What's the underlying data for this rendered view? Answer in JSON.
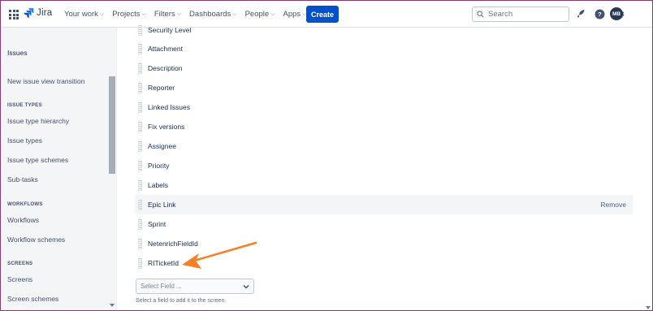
{
  "topnav": {
    "logo_text": "Jira",
    "items": [
      {
        "label": "Your work"
      },
      {
        "label": "Projects"
      },
      {
        "label": "Filters"
      },
      {
        "label": "Dashboards"
      },
      {
        "label": "People"
      },
      {
        "label": "Apps"
      }
    ],
    "create_label": "Create",
    "search_placeholder": "Search",
    "avatar_initials": "MB",
    "icons": [
      "app-switcher-icon",
      "jira-logo-icon",
      "notifications-icon",
      "help-icon",
      "settings-icon"
    ],
    "colors": {
      "create_button": "#0052cc",
      "avatar": "#253858"
    }
  },
  "sidebar": {
    "title": "Issues",
    "items": {
      "new_issue_view": "New issue view transition",
      "issue_types_section": "ISSUE TYPES",
      "issue_type_hierarchy": "Issue type hierarchy",
      "issue_types": "Issue types",
      "issue_type_schemes": "Issue type schemes",
      "sub_tasks": "Sub-tasks",
      "workflows_section": "WORKFLOWS",
      "workflows": "Workflows",
      "workflow_schemes": "Workflow schemes",
      "screens_section": "SCREENS",
      "screens": "Screens",
      "screen_schemes": "Screen schemes"
    }
  },
  "main": {
    "fields": [
      {
        "label": "Security Level"
      },
      {
        "label": "Attachment"
      },
      {
        "label": "Description"
      },
      {
        "label": "Reporter"
      },
      {
        "label": "Linked Issues"
      },
      {
        "label": "Fix versions"
      },
      {
        "label": "Assignee"
      },
      {
        "label": "Priority"
      },
      {
        "label": "Labels"
      },
      {
        "label": "Epic Link",
        "action": "Remove"
      },
      {
        "label": "Sprint"
      },
      {
        "label": "NetenrichFieldId"
      },
      {
        "label": "RITicketId"
      }
    ],
    "select_placeholder": "Select Field ...",
    "select_hint": "Select a field to add it to the screen.",
    "annotation_color": "#f58025"
  }
}
